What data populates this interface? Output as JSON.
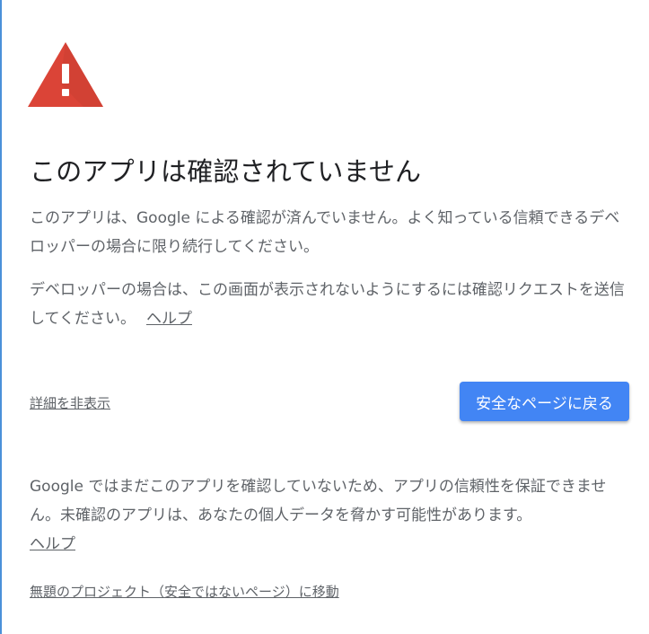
{
  "icon": "warning-triangle-icon",
  "colors": {
    "warning_red": "#db4437",
    "button_blue": "#4285f4",
    "title_text": "#202124",
    "body_text": "#5f6368"
  },
  "title": "このアプリは確認されていません",
  "intro": "このアプリは、Google による確認が済んでいません。よく知っている信頼できるデベロッパーの場合に限り続行してください。",
  "developer_text": "デベロッパーの場合は、この画面が表示されないようにするには確認リクエストを送信してください。",
  "developer_help_link": "ヘルプ",
  "hide_details_link": "詳細を非表示",
  "back_button": "安全なページに戻る",
  "details_text": "Google ではまだこのアプリを確認していないため、アプリの信頼性を保証できません。未確認のアプリは、あなたの個人データを脅かす可能性があります。",
  "details_help_link": "ヘルプ",
  "proceed_link": "無題のプロジェクト（安全ではないページ）に移動"
}
